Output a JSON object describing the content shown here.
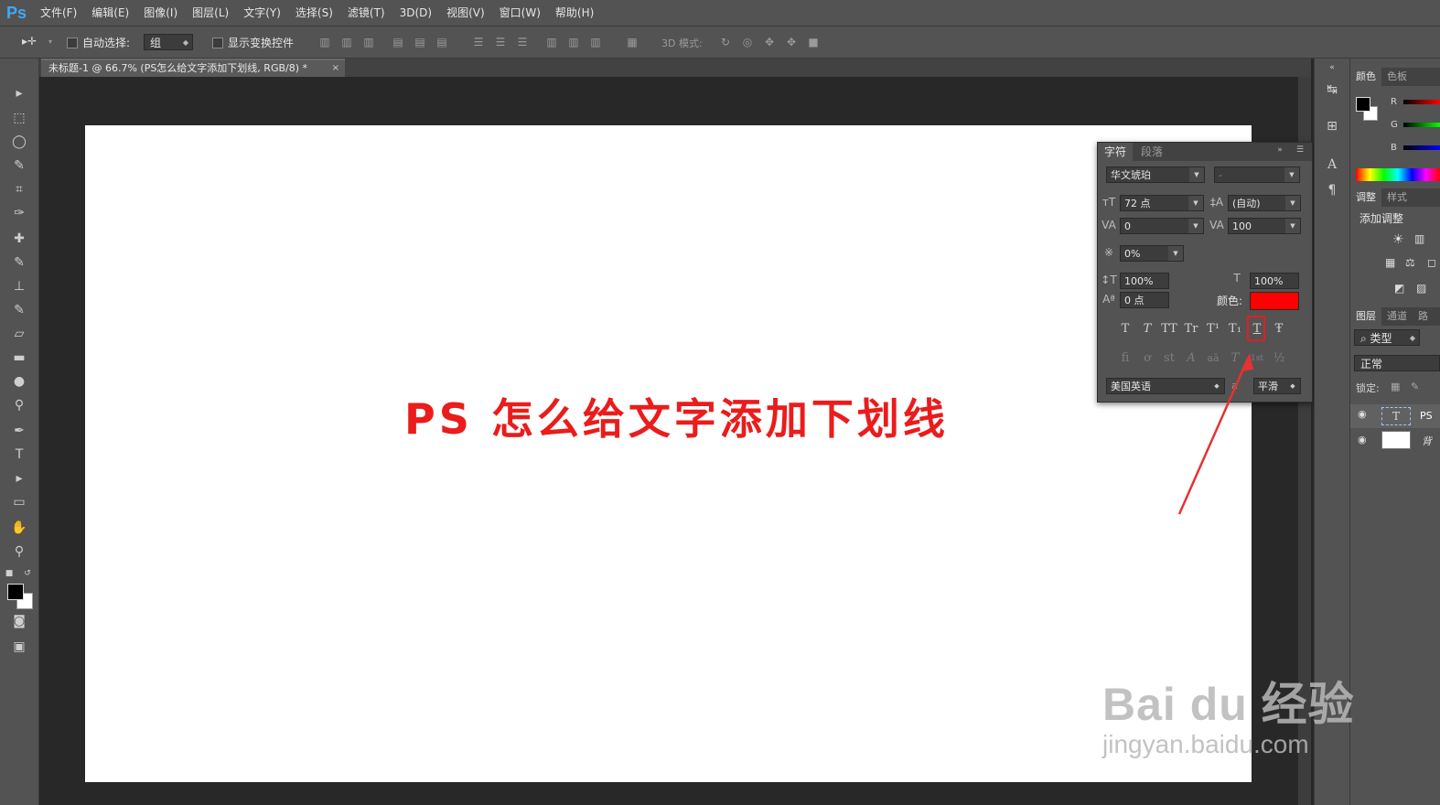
{
  "app": {
    "logo": "Ps"
  },
  "menu": [
    "文件(F)",
    "编辑(E)",
    "图像(I)",
    "图层(L)",
    "文字(Y)",
    "选择(S)",
    "滤镜(T)",
    "3D(D)",
    "视图(V)",
    "窗口(W)",
    "帮助(H)"
  ],
  "options": {
    "auto_select_label": "自动选择:",
    "auto_select_value": "组",
    "show_transform_label": "显示变换控件",
    "mode_3d_label": "3D 模式:"
  },
  "document_tab": {
    "title": "未标题-1 @ 66.7% (PS怎么给文字添加下划线, RGB/8) *",
    "close": "×"
  },
  "canvas": {
    "text": "PS 怎么给文字添加下划线",
    "text_color": "#ea1c1c"
  },
  "character_panel": {
    "tabs": [
      "字符",
      "段落"
    ],
    "font_family": "华文琥珀",
    "font_style": "-",
    "font_size": "72 点",
    "leading": "(自动)",
    "kerning": "0",
    "tracking": "100",
    "tsume": "0%",
    "vertical_scale": "100%",
    "horizontal_scale": "100%",
    "baseline_shift": "0 点",
    "color_label": "颜色:",
    "color_value": "#ff0000",
    "type_buttons": [
      "T",
      "T",
      "TT",
      "Tr",
      "T¹",
      "T₁",
      "T",
      "Ŧ"
    ],
    "opentype_buttons": [
      "ﬁ",
      "ơ",
      "st",
      "A",
      "aā",
      "T",
      "1st",
      "½"
    ],
    "language": "美国英语",
    "aa_label": "a",
    "antialias": "平滑"
  },
  "right_dock": {
    "color_tabs": [
      "颜色",
      "色板"
    ],
    "channels": [
      "R",
      "G",
      "B"
    ],
    "adjust_tabs": [
      "调整",
      "样式"
    ],
    "adjust_title": "添加调整",
    "layers_tabs": [
      "图层",
      "通道",
      "路"
    ],
    "layer_filter": "类型",
    "blend_mode": "正常",
    "lock_label": "锁定:",
    "layer_text_name": "PS",
    "layer_bg_name": "背"
  },
  "watermark": {
    "logo": "Bai du 经验",
    "url": "jingyan.baidu.com"
  }
}
